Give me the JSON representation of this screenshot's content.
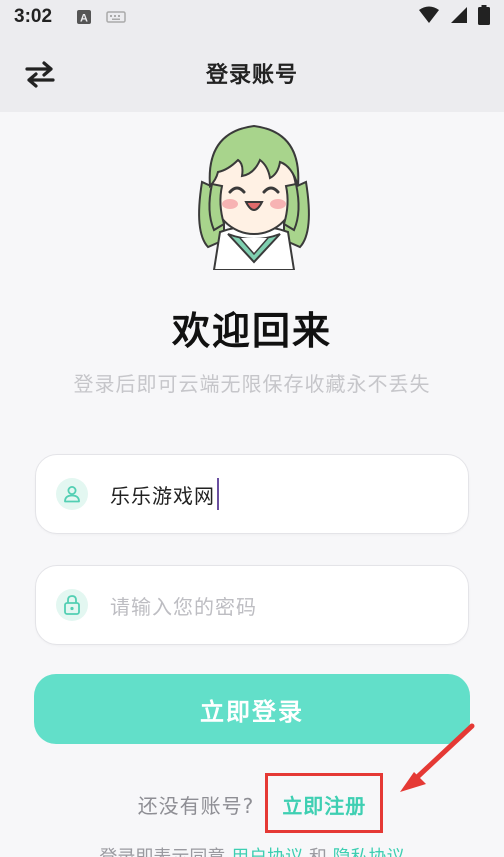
{
  "status_bar": {
    "time": "3:02",
    "icons": [
      "a-notification-icon",
      "keyboard-icon",
      "wifi-icon",
      "signal-icon",
      "battery-icon"
    ]
  },
  "header": {
    "title": "登录账号",
    "switch_icon": "swap-arrows-icon"
  },
  "welcome": {
    "title": "欢迎回来",
    "subtitle": "登录后即可云端无限保存收藏永不丢失"
  },
  "form": {
    "username": {
      "value": "乐乐游戏网",
      "icon": "user-icon"
    },
    "password": {
      "placeholder": "请输入您的密码",
      "icon": "lock-icon"
    },
    "login_label": "立即登录"
  },
  "register": {
    "question": "还没有账号?",
    "link": "立即注册"
  },
  "agreement": {
    "prefix": "登录即表示同意",
    "user_agreement": "用户协议",
    "and": "和",
    "privacy": "隐私协议"
  },
  "colors": {
    "accent": "#62dfc9",
    "link": "#3ecfb2",
    "highlight": "#e53935"
  }
}
